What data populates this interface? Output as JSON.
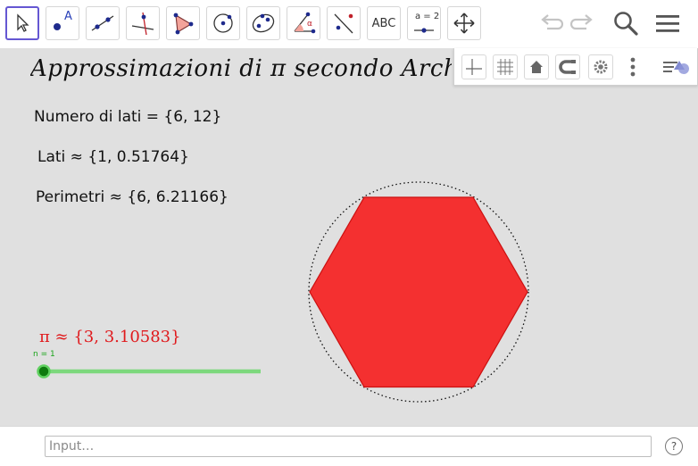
{
  "toolbar": {
    "tools": [
      {
        "name": "move-tool",
        "label": ""
      },
      {
        "name": "point-tool",
        "label": "A"
      },
      {
        "name": "line-tool",
        "label": ""
      },
      {
        "name": "perpendicular-line-tool",
        "label": ""
      },
      {
        "name": "polygon-tool",
        "label": ""
      },
      {
        "name": "circle-center-tool",
        "label": ""
      },
      {
        "name": "ellipse-tool",
        "label": ""
      },
      {
        "name": "angle-tool",
        "label": "α"
      },
      {
        "name": "reflect-tool",
        "label": ""
      },
      {
        "name": "text-tool",
        "label": "ABC"
      },
      {
        "name": "slider-tool",
        "label": "a = 2"
      },
      {
        "name": "move-graphics-view-tool",
        "label": ""
      }
    ],
    "right_icons": [
      "undo-icon",
      "redo-icon",
      "search-icon",
      "menu-icon"
    ]
  },
  "style_bar": {
    "icons": [
      "axes-icon",
      "grid-icon",
      "home-icon",
      "magnet-icon",
      "gear-icon",
      "more-vertical-icon",
      "style-bar-toggle-icon"
    ]
  },
  "canvas": {
    "title": "Approssimazioni di π secondo Archimede",
    "numero_lati": "Numero  di  lati = {6, 12}",
    "lati": "Lati ≈ {1, 0.51764}",
    "perimetri": "Perimetri ≈ {6, 6.21166}",
    "pi_value": "π ≈ {3, 3.10583}",
    "slider": {
      "label": "n = 1",
      "value_fraction": 0
    },
    "colors": {
      "polygon": "#f52a2a",
      "pi_text": "#e0191c",
      "slider": "#19a319"
    }
  },
  "input_bar": {
    "placeholder": "Input…",
    "help": "?"
  }
}
